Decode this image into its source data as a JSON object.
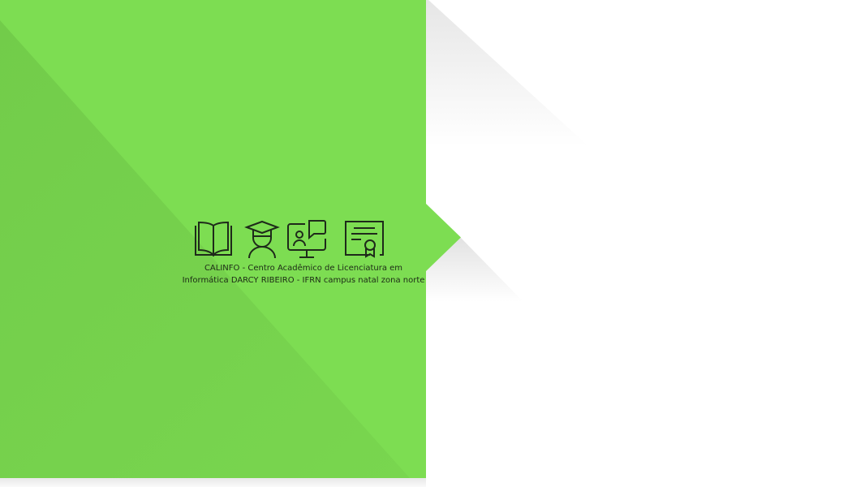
{
  "brand": {
    "icons": [
      "open-book-icon",
      "graduate-icon",
      "online-class-icon",
      "certificate-icon"
    ],
    "caption_line1": "CALINFO - Centro Acadêmico de Licenciatura em",
    "caption_line2": "Informática DARCY RIBEIRO - IFRN campus natal zona norte"
  },
  "colors": {
    "primary_green": "#7ddd52",
    "icon_stroke": "#1e2a1a"
  }
}
